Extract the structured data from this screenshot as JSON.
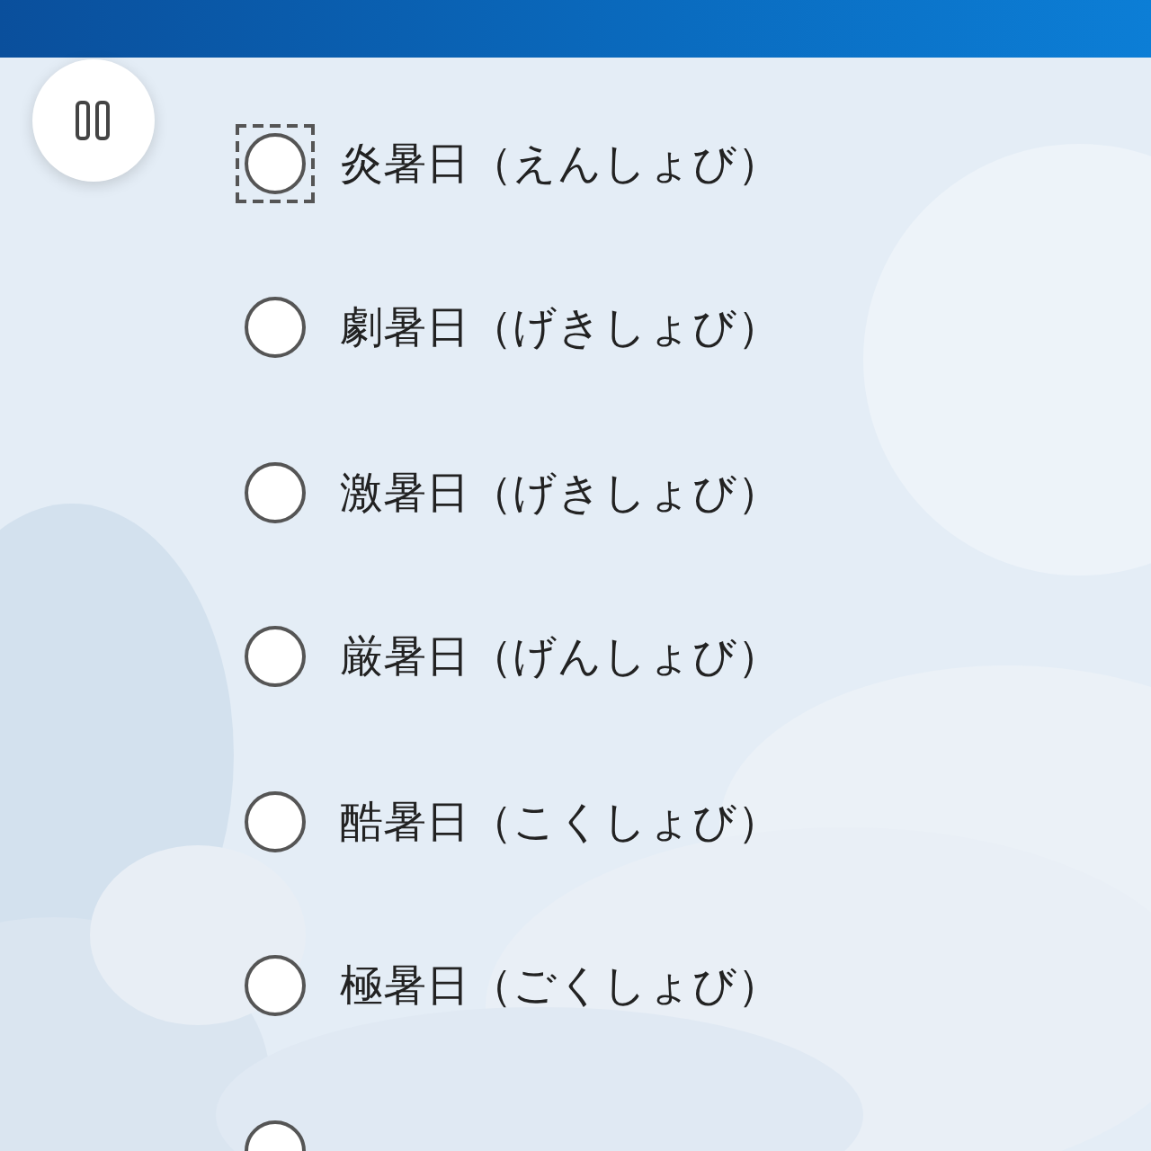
{
  "pause_button": {
    "kind": "pause"
  },
  "options": [
    {
      "label": "炎暑日（えんしょび）",
      "selected": false,
      "focused": true
    },
    {
      "label": "劇暑日（げきしょび）",
      "selected": false,
      "focused": false
    },
    {
      "label": "激暑日（げきしょび）",
      "selected": false,
      "focused": false
    },
    {
      "label": "厳暑日（げんしょび）",
      "selected": false,
      "focused": false
    },
    {
      "label": "酷暑日（こくしょび）",
      "selected": false,
      "focused": false
    },
    {
      "label": "極暑日（ごくしょび）",
      "selected": false,
      "focused": false
    },
    {
      "selected": false,
      "focused": false
    }
  ]
}
